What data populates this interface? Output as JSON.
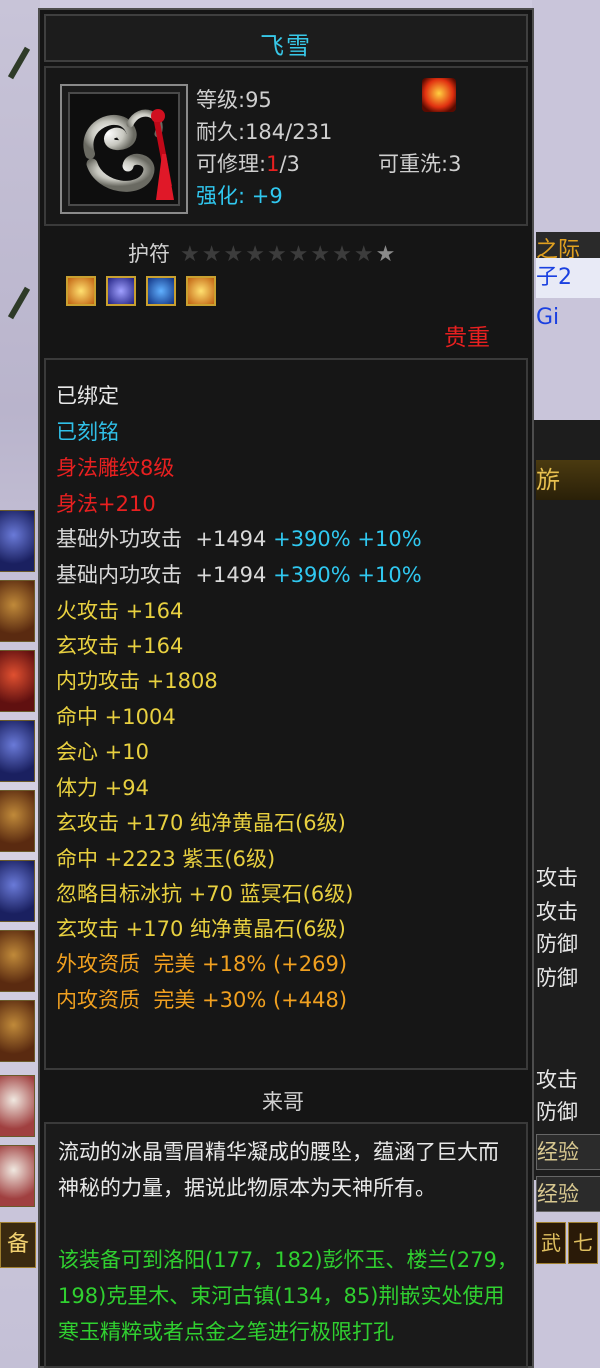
{
  "item": {
    "name": "飞雪",
    "level": "等级:95",
    "durability": "耐久:184/231",
    "repair_prefix": "可修理:",
    "repair_used": "1",
    "repair_total": "/3",
    "rewash": "可重洗:3",
    "enhance_label": "强化:",
    "enhance_value": "+9",
    "slot_type": "护符",
    "rarity": "贵重"
  },
  "attributes": {
    "bound": "已绑定",
    "engraved": "已刻铭",
    "carving": "身法雕纹8级",
    "agility": "身法+210",
    "lines": [
      {
        "name": "基础外功攻击",
        "value": "+1494",
        "pct1": "+390%",
        "pct2": "+10%"
      },
      {
        "name": "基础内功攻击",
        "value": "+1494",
        "pct1": "+390%",
        "pct2": "+10%"
      }
    ],
    "yellow": [
      "火攻击 +164",
      "玄攻击 +164",
      "内功攻击 +1808",
      "命中 +1004",
      "会心 +10",
      "体力 +94",
      "玄攻击 +170 纯净黄晶石(6级)",
      "命中 +2223 紫玉(6级)",
      "忽略目标冰抗 +70 蓝冥石(6级)",
      "玄攻击 +170 纯净黄晶石(6级)"
    ],
    "orange": [
      "外攻资质  完美 +18% (+269)",
      "内攻资质  完美 +30% (+448)"
    ]
  },
  "author": "来哥",
  "description": "流动的冰晶雪眉精华凝成的腰坠，蕴涵了巨大而神秘的力量，据说此物原本为天神所有。",
  "hint": "该装备可到洛阳(177，182)彭怀玉、楼兰(279，198)克里木、束河古镇(134，85)荆嵌实处使用寒玉精粹或者点金之笔进行极限打孔",
  "background": {
    "right_header": "旂",
    "right_gold": "之际",
    "right_blue": "子2 Gi",
    "right_rows": [
      "攻击",
      "攻击",
      "防御",
      "防御",
      "攻击",
      "防御"
    ],
    "right_exp": [
      "经验",
      "经验"
    ],
    "right_tabs": [
      "武",
      "七"
    ],
    "left_tab": "备"
  },
  "colors": {
    "title": "#38c8e8",
    "rarity": "#e82020",
    "hint": "#30d030"
  }
}
